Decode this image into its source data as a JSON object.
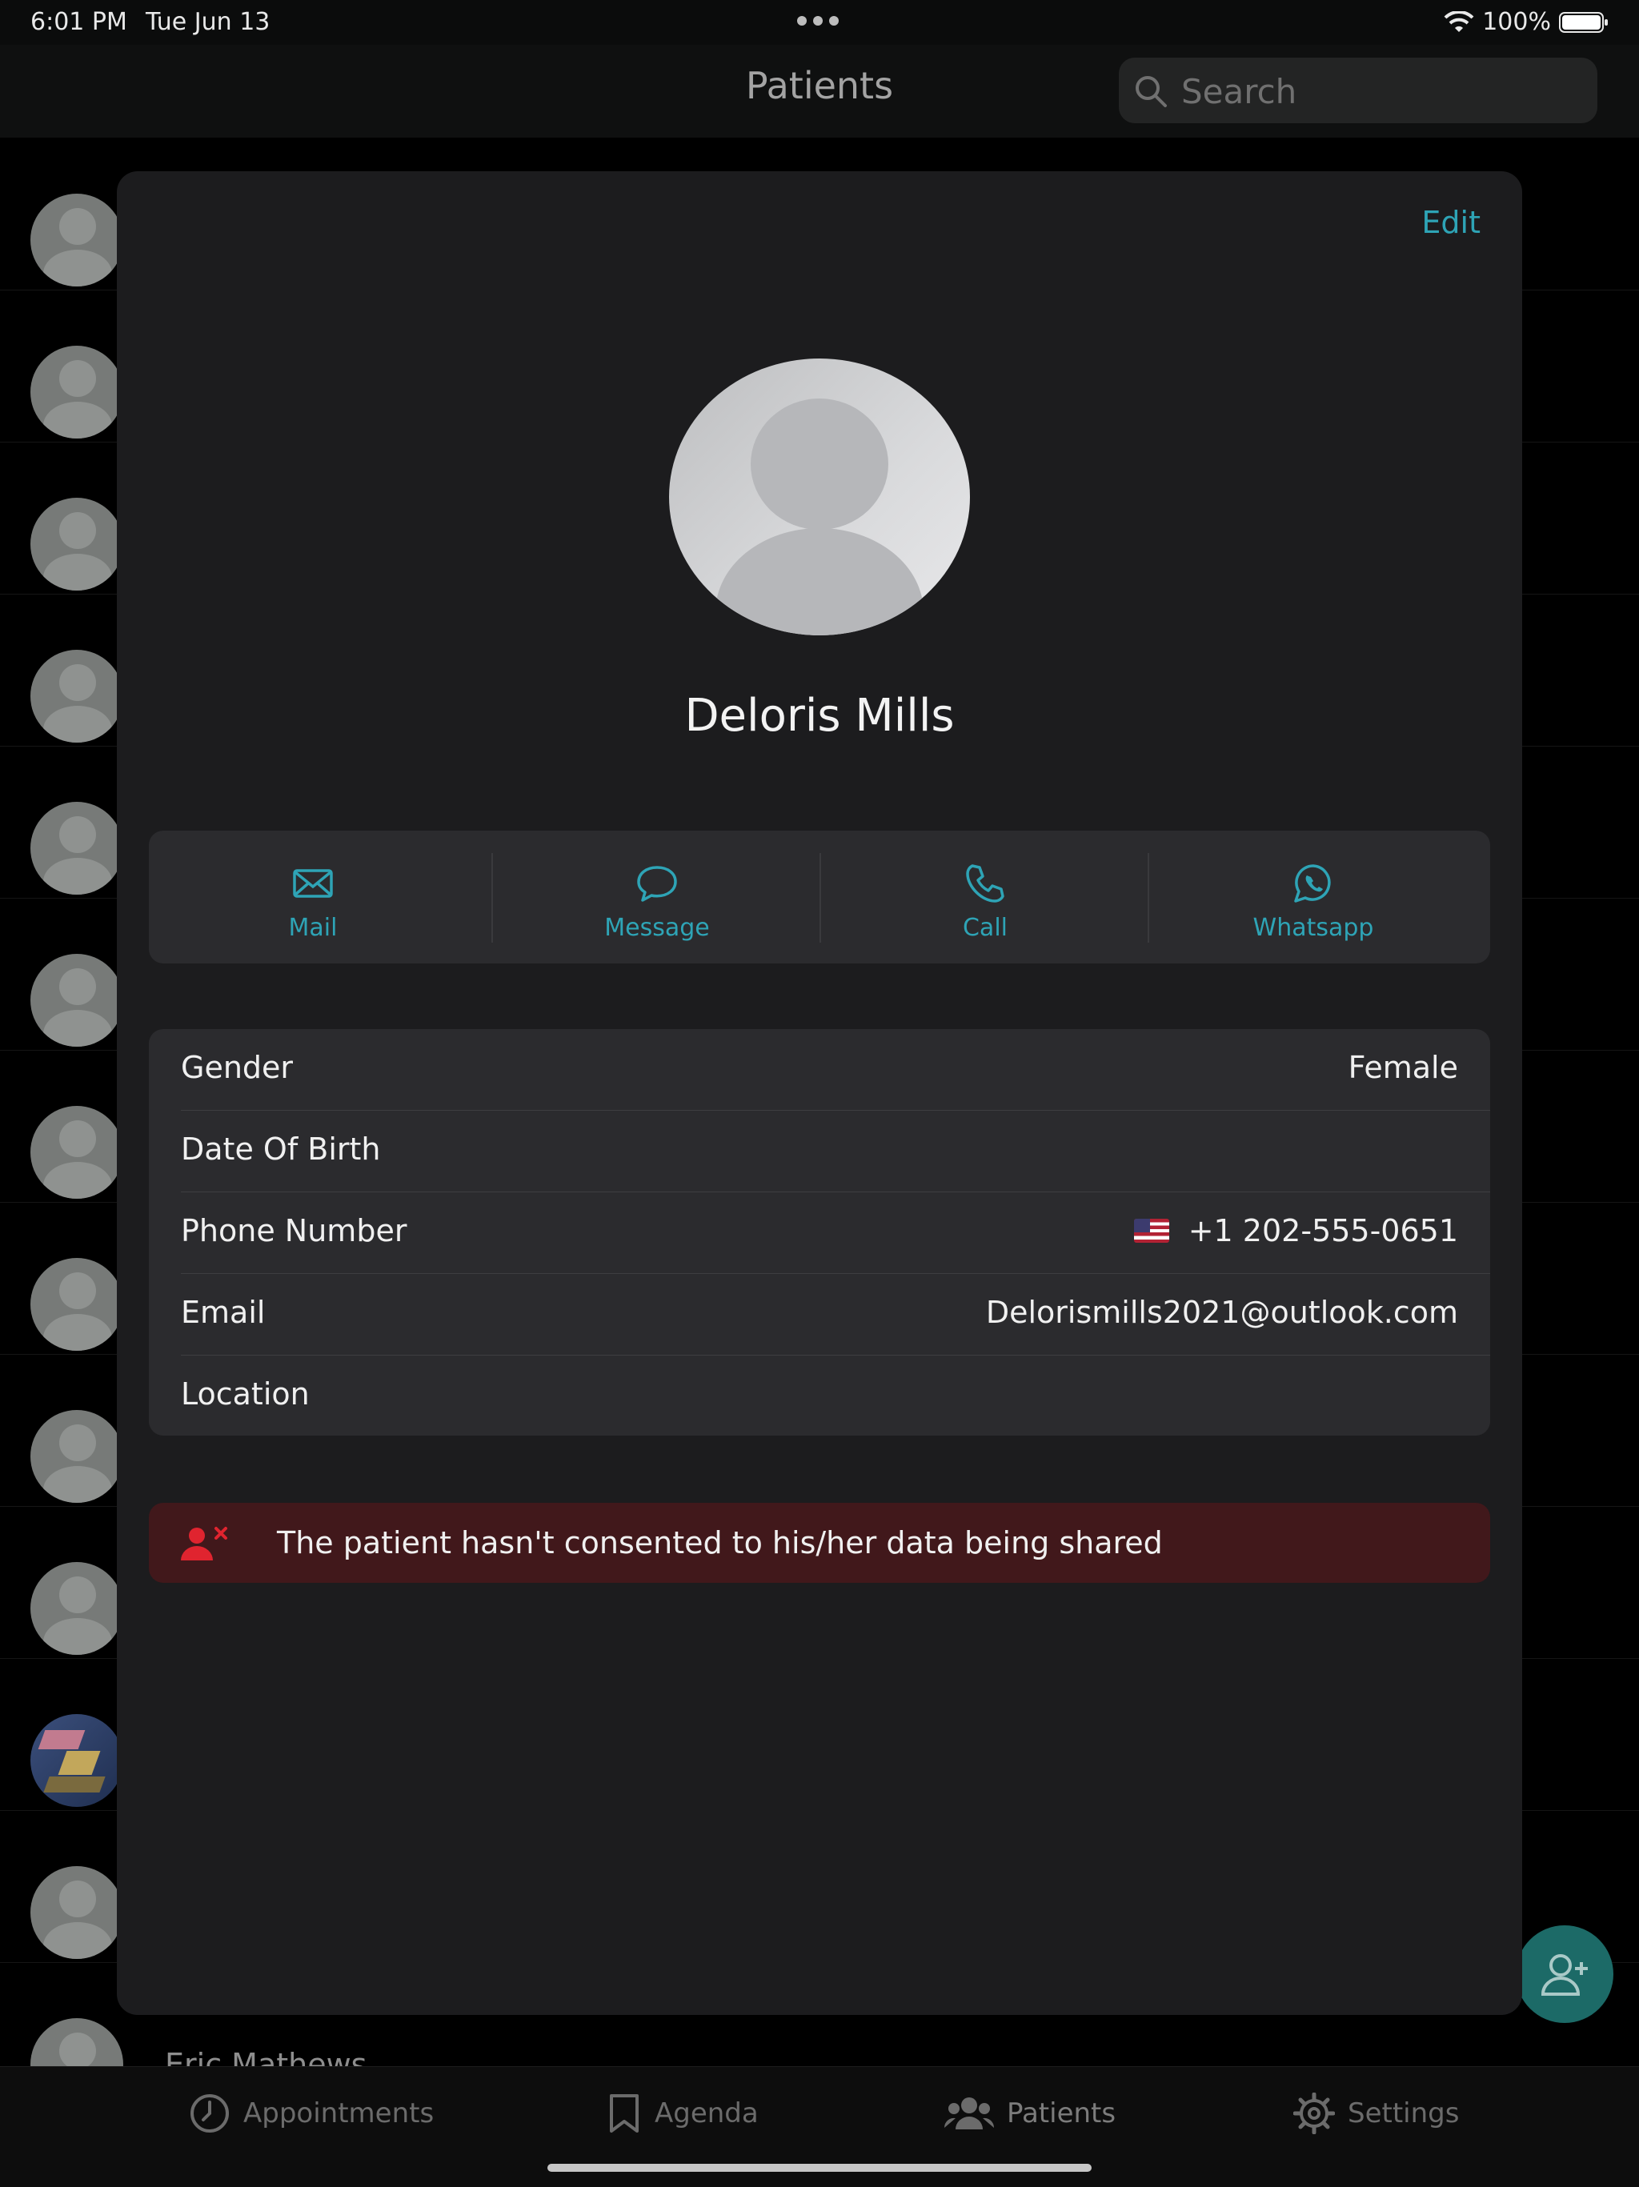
{
  "status_bar": {
    "time": "6:01 PM",
    "date": "Tue Jun 13",
    "battery": "100%"
  },
  "nav": {
    "title": "Patients",
    "search_placeholder": "Search"
  },
  "list": {
    "visible_name": "Eric Mathews"
  },
  "sheet": {
    "edit_label": "Edit",
    "patient_name": "Deloris Mills",
    "actions": [
      {
        "label": "Mail",
        "icon": "mail-icon"
      },
      {
        "label": "Message",
        "icon": "message-icon"
      },
      {
        "label": "Call",
        "icon": "phone-icon"
      },
      {
        "label": "Whatsapp",
        "icon": "whatsapp-icon"
      }
    ],
    "info": {
      "gender": {
        "label": "Gender",
        "value": "Female"
      },
      "dob": {
        "label": "Date Of Birth",
        "value": ""
      },
      "phone": {
        "label": "Phone Number",
        "value": "+1 202-555-0651",
        "flag_icon": "us-flag-icon"
      },
      "email": {
        "label": "Email",
        "value": "Delorismills2021@outlook.com"
      },
      "location": {
        "label": "Location",
        "value": ""
      }
    },
    "consent_warning": "The patient hasn't consented to his/her data being shared"
  },
  "tabs": [
    {
      "label": "Appointments",
      "icon": "clock-icon"
    },
    {
      "label": "Agenda",
      "icon": "bookmark-icon"
    },
    {
      "label": "Patients",
      "icon": "people-icon"
    },
    {
      "label": "Settings",
      "icon": "gear-icon"
    }
  ],
  "colors": {
    "accent": "#2ea4b6",
    "warning_bg": "#41181b",
    "sheet_bg": "#1c1c1e",
    "card_bg": "#2b2b2e"
  }
}
